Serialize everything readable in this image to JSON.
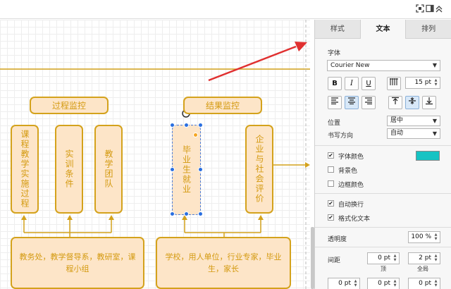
{
  "panel": {
    "tabs": [
      "样式",
      "文本",
      "排列"
    ],
    "font_section": "字体",
    "font_name": "Courier New",
    "bold": "B",
    "italic": "I",
    "underline": "U",
    "font_size": "15 pt",
    "position_label": "位置",
    "position_value": "居中",
    "direction_label": "书写方向",
    "direction_value": "自动",
    "font_color_label": "字体颜色",
    "font_color": "#17c3c3",
    "background_label": "背景色",
    "border_label": "边框颜色",
    "autowrap_label": "自动换行",
    "formatted_label": "格式化文本",
    "opacity_label": "透明度",
    "opacity_value": "100 %",
    "spacing_label": "间距",
    "spacing_top": "0 pt",
    "spacing_top_label": "顶",
    "spacing_all": "2 pt",
    "spacing_all_label": "全局",
    "spacing_left": "0 pt",
    "spacing_mid": "0 pt",
    "spacing_right": "0 pt"
  },
  "diagram": {
    "process_title": "过程监控",
    "result_title": "结果监控",
    "box1": "课程教学实施过程",
    "box2": "实训条件",
    "box3": "教学团队",
    "box4": "毕业生就业",
    "box5": "企业与社会评价",
    "bottom_left": "教务处，教学督导系，教研室，课程小组",
    "bottom_right": "学校，用人单位，行业专家，毕业生，家长"
  },
  "colors": {
    "box_fill": "#fde5c8",
    "box_border": "#d4a21c",
    "text": "#d49a10",
    "arrow": "#e03030"
  }
}
